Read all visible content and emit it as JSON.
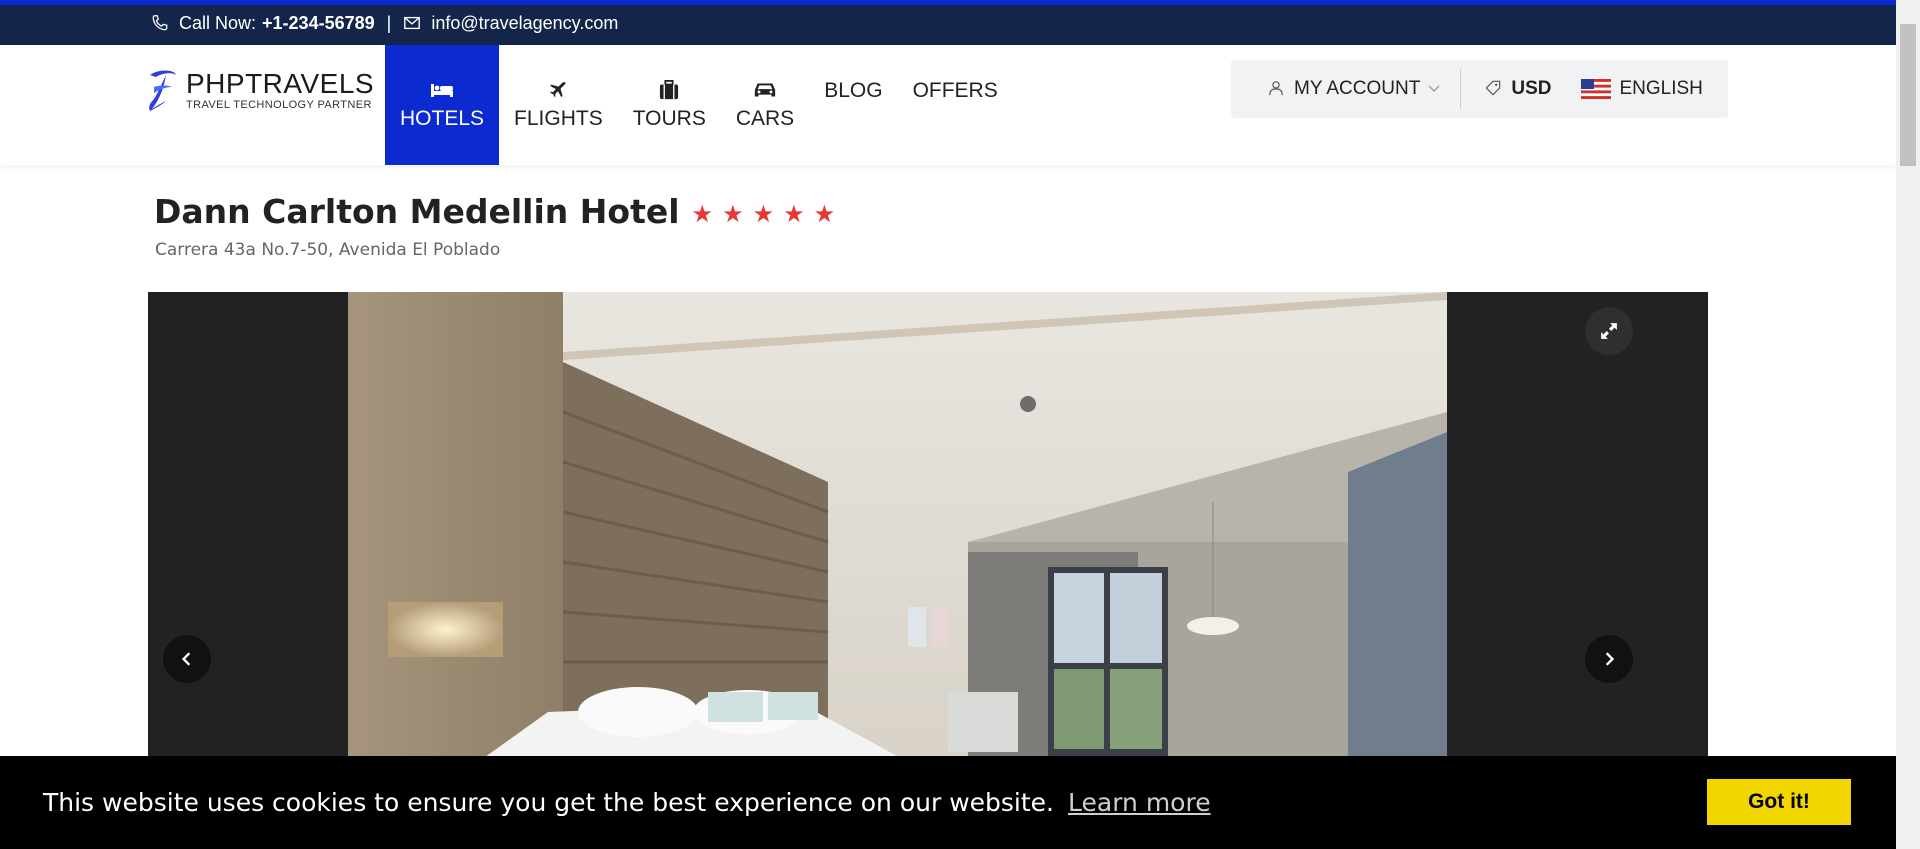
{
  "topbar": {
    "call_label": "Call Now:",
    "phone": "+1-234-56789",
    "separator": "|",
    "email": "info@travelagency.com"
  },
  "header": {
    "logo_title": "PHPTRAVELS",
    "logo_subtitle": "TRAVEL TECHNOLOGY PARTNER",
    "nav": [
      {
        "label": "HOTELS",
        "icon": "bed-icon",
        "active": true
      },
      {
        "label": "FLIGHTS",
        "icon": "plane-icon"
      },
      {
        "label": "TOURS",
        "icon": "suitcase-icon"
      },
      {
        "label": "CARS",
        "icon": "car-icon"
      },
      {
        "label": "BLOG"
      },
      {
        "label": "OFFERS"
      }
    ],
    "account_label": "MY ACCOUNT",
    "currency": "USD",
    "language": "ENGLISH"
  },
  "hotel": {
    "name": "Dann Carlton Medellin Hotel",
    "stars": 5,
    "address": "Carrera 43a No.7-50, Avenida El Poblado"
  },
  "cookie": {
    "message": "This website uses cookies to ensure you get the best experience on our website.",
    "link": "Learn more",
    "button": "Got it!"
  },
  "colors": {
    "topbar_bg": "#14254a",
    "accent_blue": "#0b2bd0",
    "star_red": "#e53935",
    "cookie_button": "#f1d600"
  }
}
